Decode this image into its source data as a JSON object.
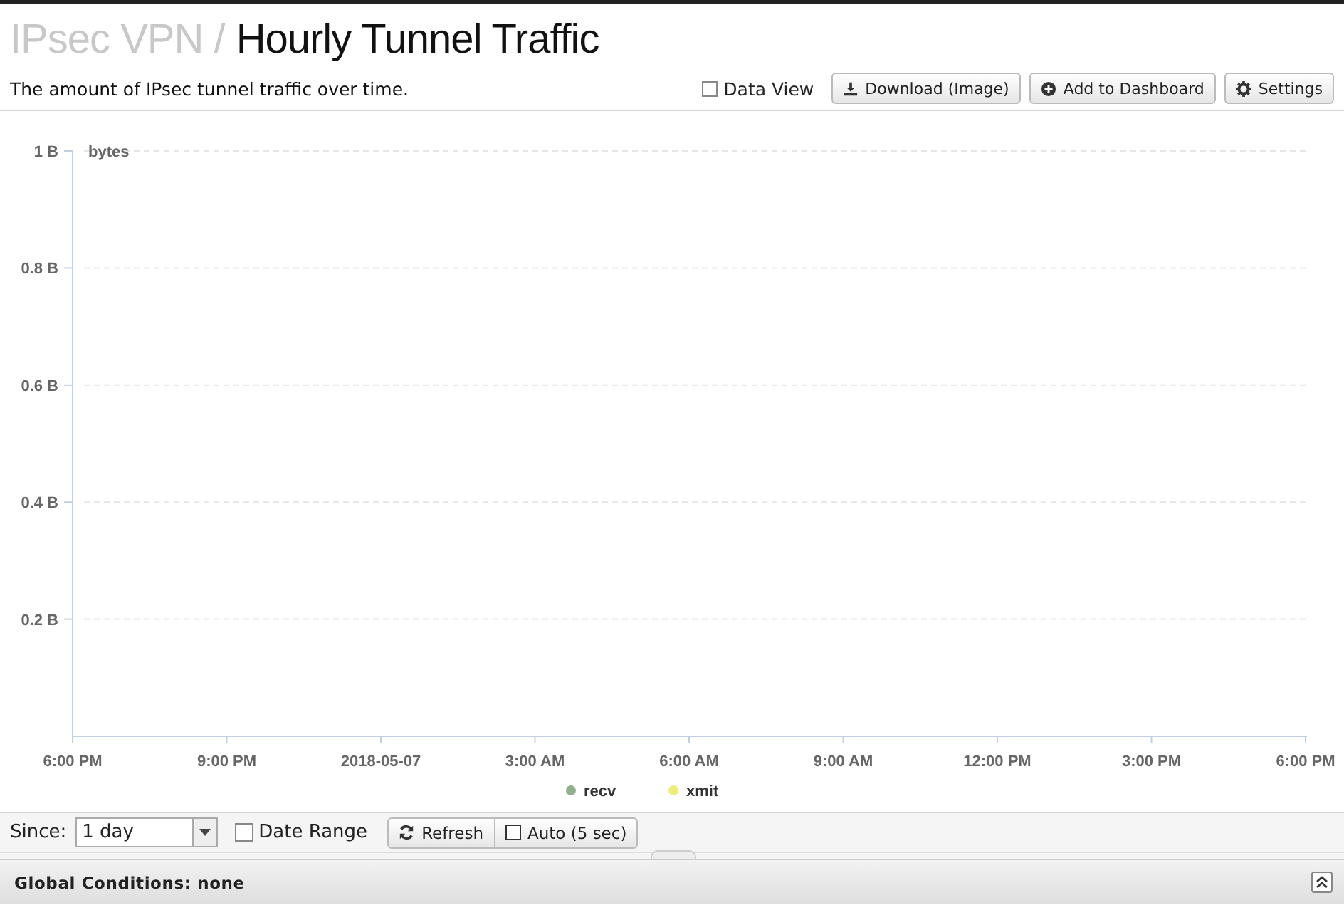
{
  "header": {
    "section": "IPsec VPN /",
    "title": "Hourly Tunnel Traffic"
  },
  "description": "The amount of IPsec tunnel traffic over time.",
  "toolbar": {
    "data_view": {
      "label": "Data View",
      "checked": false
    },
    "buttons": [
      {
        "label": "Download (Image)",
        "kind": "download"
      },
      {
        "label": "Add to Dashboard",
        "kind": "add"
      },
      {
        "label": "Settings",
        "kind": "settings"
      }
    ]
  },
  "chart": {
    "chart_data": {
      "type": "line",
      "ylabel": "bytes",
      "ylim": [
        0,
        1
      ],
      "yticks": [
        {
          "value": 0.2,
          "label": "0.2 B"
        },
        {
          "value": 0.4,
          "label": "0.4 B"
        },
        {
          "value": 0.6,
          "label": "0.6 B"
        },
        {
          "value": 0.8,
          "label": "0.8 B"
        },
        {
          "value": 1,
          "label": "1 B"
        }
      ],
      "categories": [
        "6:00 PM",
        "9:00 PM",
        "2018-05-07",
        "3:00 AM",
        "6:00 AM",
        "9:00 AM",
        "12:00 PM",
        "3:00 PM",
        "6:00 PM"
      ],
      "grid": true,
      "series": [
        {
          "name": "recv",
          "color": "#90b08c",
          "values": [
            null,
            null,
            null,
            null,
            null,
            null,
            null,
            null,
            null
          ]
        },
        {
          "name": "xmit",
          "color": "#eeee77",
          "values": [
            null,
            null,
            null,
            null,
            null,
            null,
            null,
            null,
            null
          ]
        }
      ]
    }
  },
  "controls": {
    "since_label": "Since:",
    "since_value": "1 day",
    "date_range": {
      "label": "Date Range",
      "checked": false
    },
    "refresh": "Refresh",
    "auto": {
      "label": "Auto (5 sec)",
      "checked": false
    }
  },
  "footer": {
    "label": "Global Conditions: none",
    "expanded": false
  }
}
